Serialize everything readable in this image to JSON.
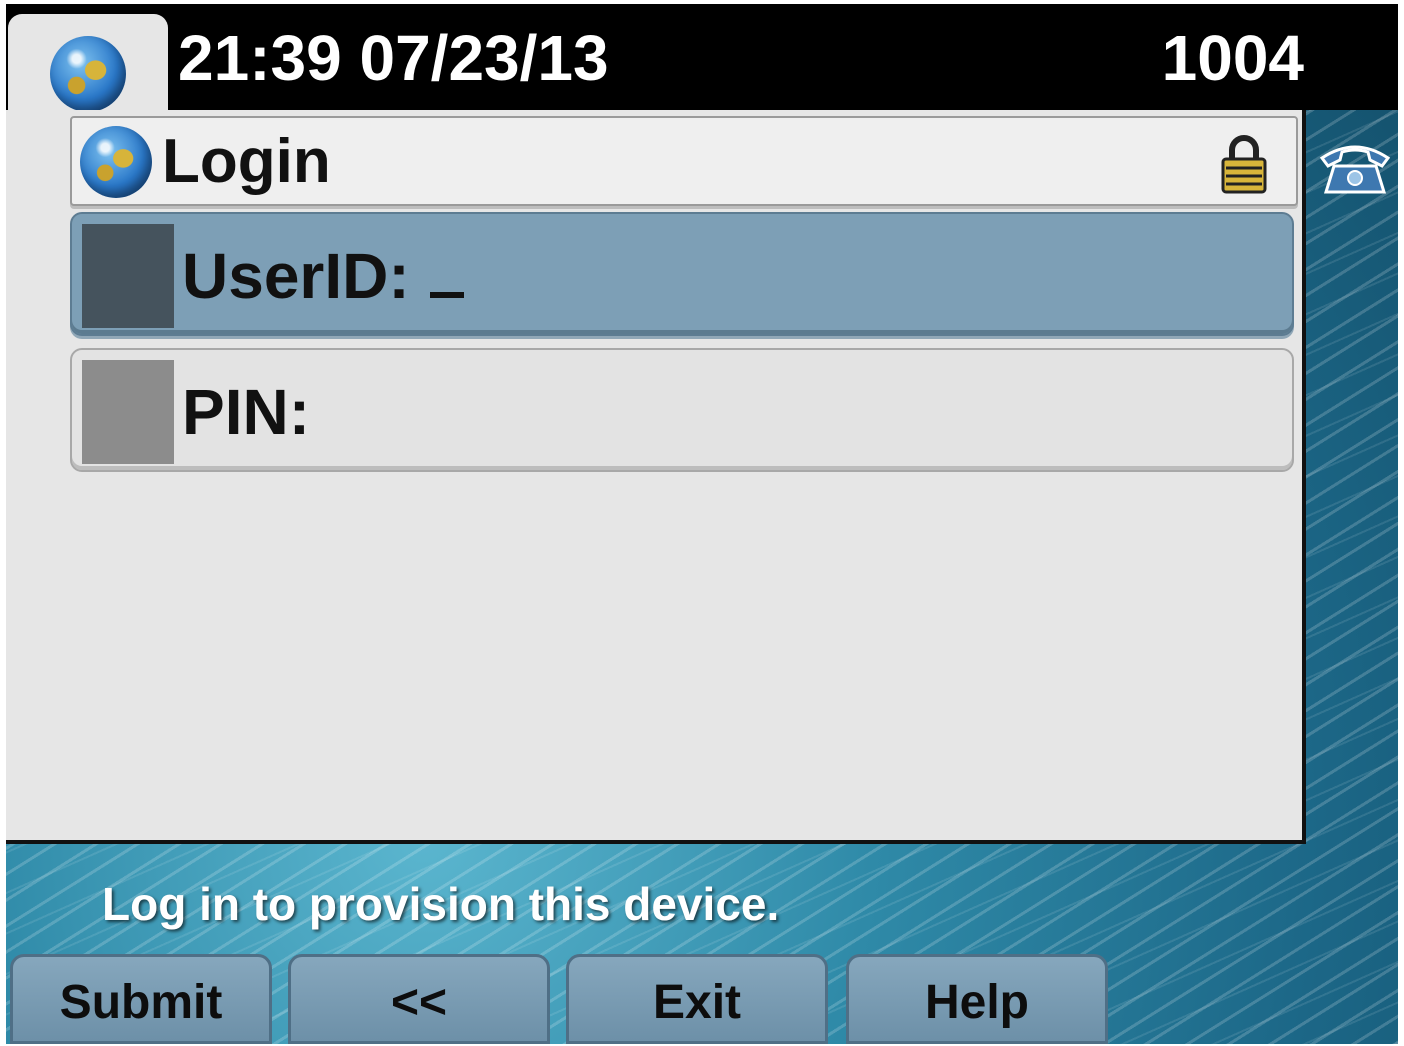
{
  "status_bar": {
    "datetime": "21:39 07/23/13",
    "extension": "1004",
    "tab_icon": "globe-icon",
    "line_icon": "phone-icon"
  },
  "header": {
    "title": "Login",
    "icon": "globe-icon",
    "lock_icon": "lock-icon"
  },
  "fields": [
    {
      "label": "UserID:",
      "value": "",
      "selected": true
    },
    {
      "label": "PIN:",
      "value": "",
      "selected": false
    }
  ],
  "prompt": "Log in to provision this device.",
  "softkeys": [
    "Submit",
    "<<",
    "Exit",
    "Help"
  ],
  "colors": {
    "selected_field": "#7d9fb6",
    "status_bar": "#000000",
    "panel": "#e6e6e6"
  }
}
